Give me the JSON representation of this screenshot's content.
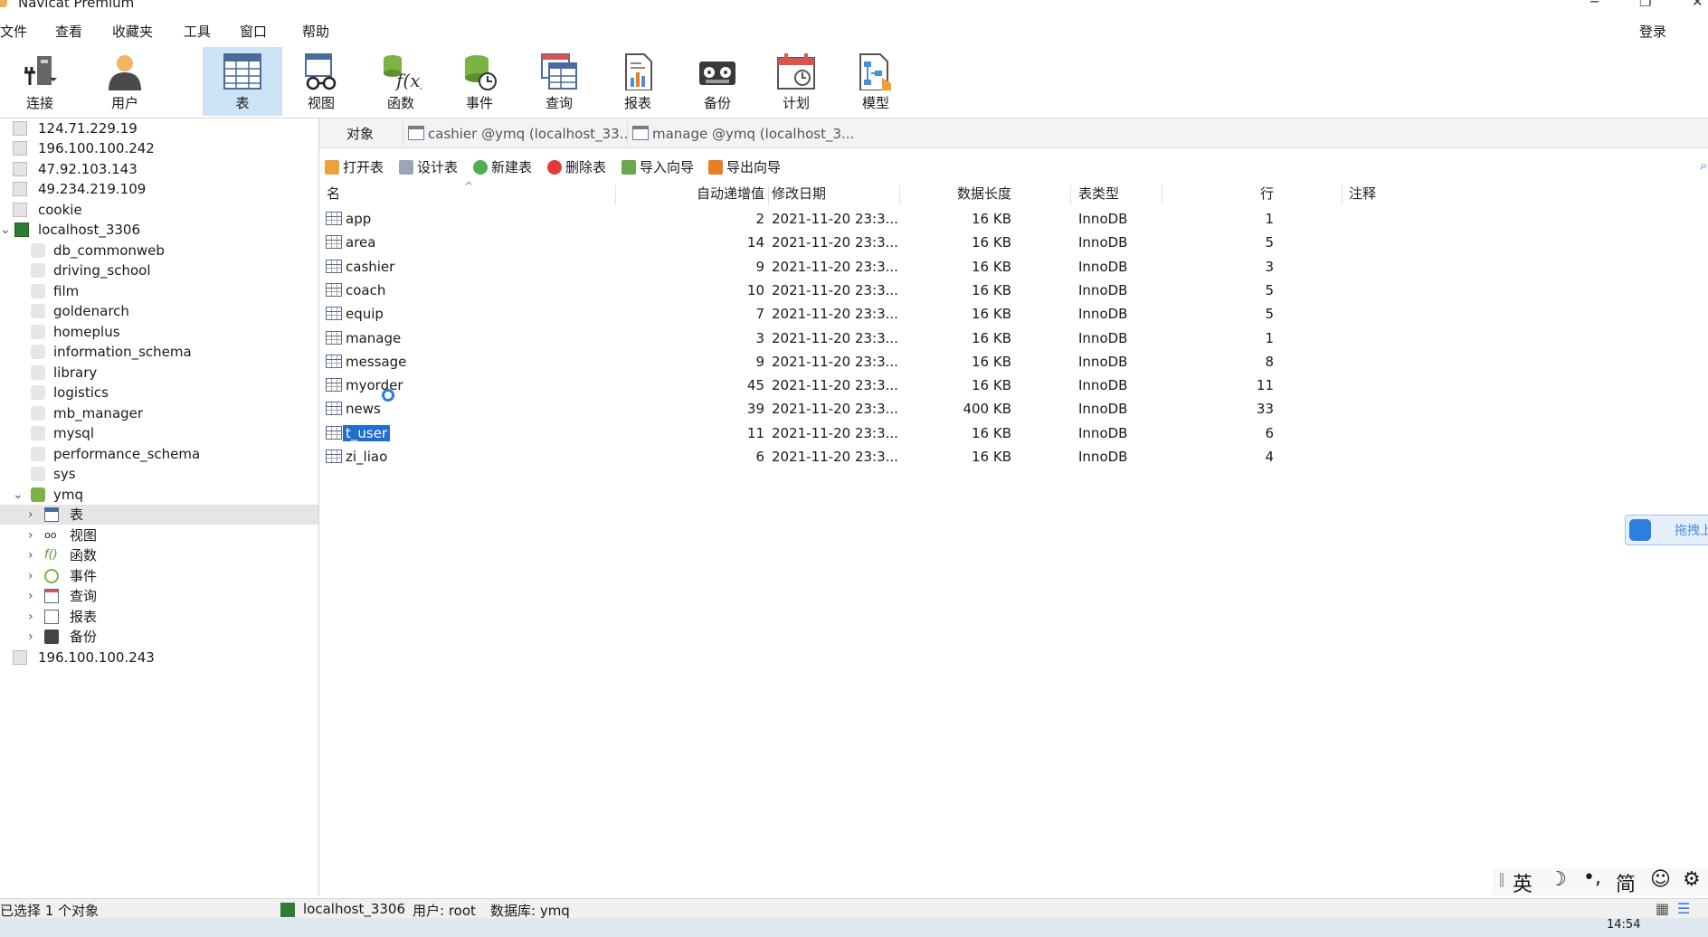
{
  "window": {
    "title": "Navicat Premium"
  },
  "menubar": {
    "items": [
      "文件",
      "查看",
      "收藏夹",
      "工具",
      "窗口",
      "帮助"
    ],
    "login": "登录"
  },
  "toolbar": {
    "buttons": [
      {
        "label": "连接",
        "icon": "connection-plug-icon"
      },
      {
        "label": "用户",
        "icon": "user-icon"
      },
      {
        "label": "表",
        "icon": "table-icon",
        "active": true
      },
      {
        "label": "视图",
        "icon": "view-glasses-icon"
      },
      {
        "label": "函数",
        "icon": "function-icon"
      },
      {
        "label": "事件",
        "icon": "event-clock-icon"
      },
      {
        "label": "查询",
        "icon": "query-icon"
      },
      {
        "label": "报表",
        "icon": "report-icon"
      },
      {
        "label": "备份",
        "icon": "backup-icon"
      },
      {
        "label": "计划",
        "icon": "schedule-calendar-icon"
      },
      {
        "label": "模型",
        "icon": "model-icon"
      }
    ]
  },
  "sidebar": {
    "connections_top": [
      "124.71.229.19",
      "196.100.100.242",
      "47.92.103.143",
      "49.234.219.109",
      "cookie"
    ],
    "localhost": "localhost_3306",
    "databases": [
      "db_commonweb",
      "driving_school",
      "film",
      "goldenarch",
      "homeplus",
      "information_schema",
      "library",
      "logistics",
      "mb_manager",
      "mysql",
      "performance_schema",
      "sys"
    ],
    "open_db": "ymq",
    "db_children": [
      {
        "label": "表",
        "icon": "table-icon",
        "selected": true
      },
      {
        "label": "视图",
        "icon": "view-glasses-icon"
      },
      {
        "label": "函数",
        "icon": "function-icon"
      },
      {
        "label": "事件",
        "icon": "event-clock-icon"
      },
      {
        "label": "查询",
        "icon": "query-icon"
      },
      {
        "label": "报表",
        "icon": "report-icon"
      },
      {
        "label": "备份",
        "icon": "backup-icon"
      }
    ],
    "connections_bottom": [
      "196.100.100.243"
    ]
  },
  "tabs": {
    "object_tab": "对象",
    "open_tabs": [
      "cashier @ymq (localhost_33...",
      "manage @ymq (localhost_3..."
    ]
  },
  "actions": [
    "打开表",
    "设计表",
    "新建表",
    "删除表",
    "导入向导",
    "导出向导"
  ],
  "table": {
    "columns": [
      "名",
      "自动递增值",
      "修改日期",
      "数据长度",
      "表类型",
      "行",
      "注释"
    ],
    "rows": [
      {
        "name": "app",
        "auto": "2",
        "date": "2021-11-20 23:3...",
        "size": "16 KB",
        "engine": "InnoDB",
        "rows": "1"
      },
      {
        "name": "area",
        "auto": "14",
        "date": "2021-11-20 23:3...",
        "size": "16 KB",
        "engine": "InnoDB",
        "rows": "5"
      },
      {
        "name": "cashier",
        "auto": "9",
        "date": "2021-11-20 23:3...",
        "size": "16 KB",
        "engine": "InnoDB",
        "rows": "3"
      },
      {
        "name": "coach",
        "auto": "10",
        "date": "2021-11-20 23:3...",
        "size": "16 KB",
        "engine": "InnoDB",
        "rows": "5"
      },
      {
        "name": "equip",
        "auto": "7",
        "date": "2021-11-20 23:3...",
        "size": "16 KB",
        "engine": "InnoDB",
        "rows": "5"
      },
      {
        "name": "manage",
        "auto": "3",
        "date": "2021-11-20 23:3...",
        "size": "16 KB",
        "engine": "InnoDB",
        "rows": "1"
      },
      {
        "name": "message",
        "auto": "9",
        "date": "2021-11-20 23:3...",
        "size": "16 KB",
        "engine": "InnoDB",
        "rows": "8"
      },
      {
        "name": "myorder",
        "auto": "45",
        "date": "2021-11-20 23:3...",
        "size": "16 KB",
        "engine": "InnoDB",
        "rows": "11"
      },
      {
        "name": "news",
        "auto": "39",
        "date": "2021-11-20 23:3...",
        "size": "400 KB",
        "engine": "InnoDB",
        "rows": "33"
      },
      {
        "name": "t_user",
        "auto": "11",
        "date": "2021-11-20 23:3...",
        "size": "16 KB",
        "engine": "InnoDB",
        "rows": "6",
        "selected": true
      },
      {
        "name": "zi_liao",
        "auto": "6",
        "date": "2021-11-20 23:3...",
        "size": "16 KB",
        "engine": "InnoDB",
        "rows": "4"
      }
    ]
  },
  "status": {
    "selection": "已选择 1 个对象",
    "connection": "localhost_3306",
    "user": "用户: root",
    "database": "数据库: ymq"
  },
  "ime": {
    "chars": [
      "英",
      "简"
    ]
  },
  "baidu_widget": {
    "label": "拖拽上"
  },
  "taskbar": {
    "time": "14:54"
  },
  "colors": {
    "selection": "#1f6fd1",
    "toolbar_active": "#cde4f7",
    "db_green": "#7cb342"
  }
}
